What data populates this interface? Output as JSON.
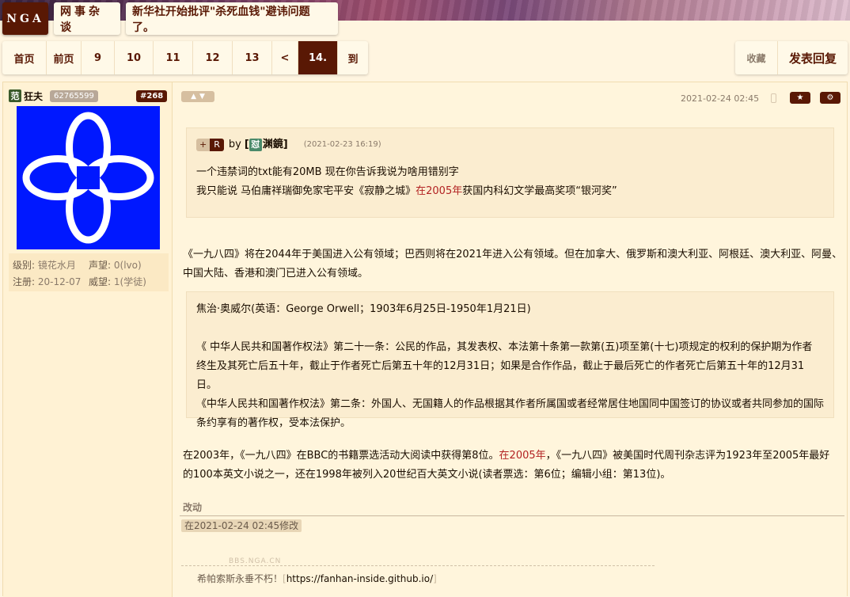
{
  "header": {
    "logo": "NGA",
    "board": "网事杂谈",
    "thread_title": "新华社开始批评\"杀死血钱\"避讳问题了。"
  },
  "pager": {
    "first": "首页",
    "prev": "前页",
    "pages": [
      "9",
      "10",
      "11",
      "12",
      "13"
    ],
    "back": "<",
    "current": "14.",
    "goto": "到"
  },
  "toolbar": {
    "favorite": "收藏",
    "reply": "发表回复"
  },
  "user": {
    "badge": "范",
    "name": "狂夫",
    "uid": "62765599",
    "floor": "#268",
    "level_label": "级别:",
    "level": "镜花水月",
    "fame_label": "声望:",
    "fame": "0(lvo)",
    "reg_label": "注册:",
    "reg": "20-12-07",
    "prestige_label": "威望:",
    "prestige": "1(学徒)"
  },
  "post": {
    "date": "2021-02-24 02:45",
    "quote": {
      "plus": "+",
      "r": "R",
      "by": "by",
      "user_badge": "怼",
      "user": "渊鏡",
      "date": "(2021-02-23 16:19)",
      "line1": "一个违禁词的txt能有20MB 现在你告诉我说为啥用错别字",
      "line2_a": "我只能说 马伯庸祥瑞御免家宅平安《寂静之城》",
      "line2_red": "在2005年",
      "line2_b": "获国内科幻文学最高奖项“银河奖”"
    },
    "p1_line1": "《一九八四》将在2044年于美国进入公有领域；巴西则将在2021年进入公有领域。但在加拿大、俄罗斯和澳大利亚、阿根廷、澳大利亚、阿曼、",
    "p1_line2": "中国大陆、香港和澳门已进入公有领域。",
    "quote2": {
      "line1": "焦治·奥威尔(英语：George Orwell；1903年6月25日-1950年1月21日)",
      "line2": "《 中华人民共和国著作权法》第二十一条：公民的作品，其发表权、本法第十条第一款第(五)项至第(十七)项规定的权利的保护期为作者",
      "line3": "终生及其死亡后五十年，截止于作者死亡后第五十年的12月31日；如果是合作作品，截止于最后死亡的作者死亡后第五十年的12月31日。",
      "line4": "《中华人民共和国著作权法》第二条：外国人、无国籍人的作品根据其作者所属国或者经常居住地国同中国签订的协议或者共同参加的国际",
      "line5": "条约享有的著作权，受本法保护。"
    },
    "p2_line1_a": "在2003年，《一九八四》在BBC的书籍票选活动大阅读中获得第8位。",
    "p2_line1_red": "在2005年",
    "p2_line1_b": "，《一九八四》被美国时代周刊杂志评为1923年至2005年最好",
    "p2_line2": "的100本英文小说之一，还在1998年被列入20世纪百大英文小说(读者票选：第6位；编辑小组：第13位)。",
    "edit_label": "改动",
    "edit_time": "在2021-02-24 02:45修改",
    "watermark": "BBS.NGA.CN",
    "sig_text": "希帕索斯永垂不朽！",
    "sig_link": "https://fanhan-inside.github.io/",
    "sig_open": "[",
    "sig_close": "]"
  }
}
